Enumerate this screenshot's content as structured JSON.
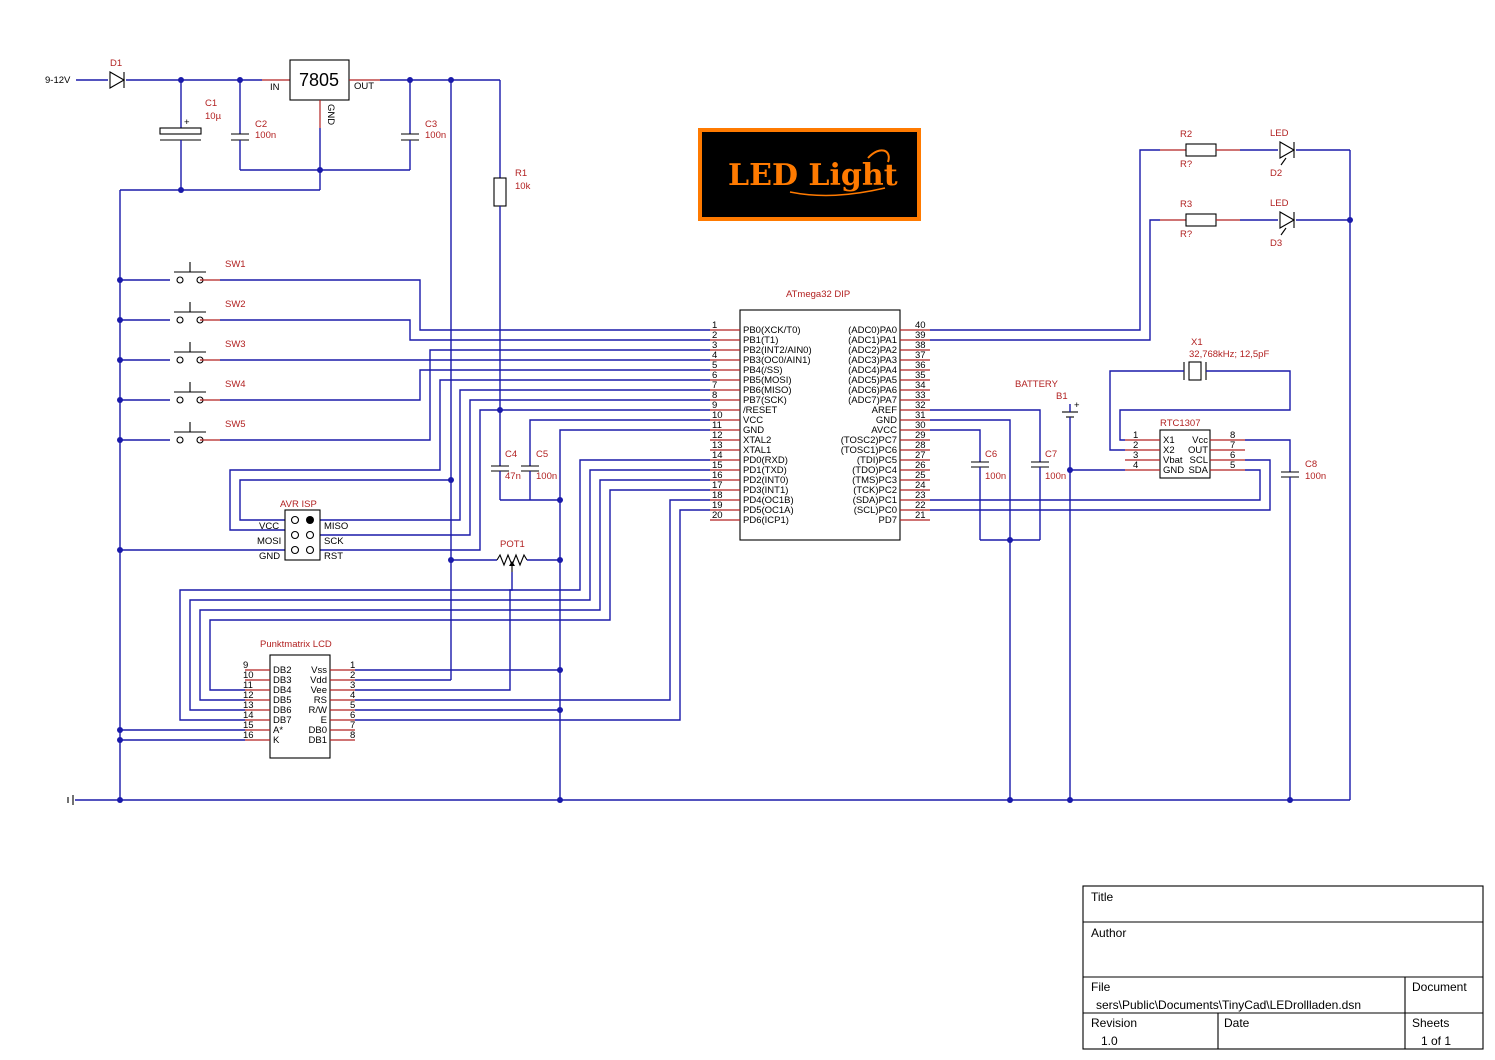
{
  "input_label": "9-12V",
  "components": {
    "d1": "D1",
    "c1": {
      "ref": "C1",
      "value": "10µ"
    },
    "c2": {
      "ref": "C2",
      "value": "100n"
    },
    "c3": {
      "ref": "C3",
      "value": "100n"
    },
    "c4": {
      "ref": "C4",
      "value": "47n"
    },
    "c5": {
      "ref": "C5",
      "value": "100n"
    },
    "c6": {
      "ref": "C6",
      "value": "100n"
    },
    "c7": {
      "ref": "C7",
      "value": "100n"
    },
    "c8": {
      "ref": "C8",
      "value": "100n"
    },
    "r1": {
      "ref": "R1",
      "value": "10k"
    },
    "r2": {
      "ref": "R2",
      "value": "R?"
    },
    "r3": {
      "ref": "R3",
      "value": "R?"
    },
    "led2": {
      "type": "LED",
      "ref": "D2"
    },
    "led3": {
      "type": "LED",
      "ref": "D3"
    },
    "regulator": {
      "name": "7805",
      "in": "IN",
      "out": "OUT",
      "gnd": "GND"
    },
    "switches": [
      "SW1",
      "SW2",
      "SW3",
      "SW4",
      "SW5"
    ],
    "pot": "POT1",
    "battery": {
      "label": "BATTERY",
      "ref": "B1"
    },
    "crystal": {
      "ref": "X1",
      "value": "32,768kHz; 12,5pF"
    },
    "isp": {
      "title": "AVR ISP",
      "left": [
        "VCC",
        "MOSI",
        "GND"
      ],
      "right": [
        "MISO",
        "SCK",
        "RST"
      ]
    },
    "rtc": {
      "title": "RTC1307",
      "left_pins": [
        {
          "num": "1",
          "name": "X1"
        },
        {
          "num": "2",
          "name": "X2"
        },
        {
          "num": "3",
          "name": "Vbat"
        },
        {
          "num": "4",
          "name": "GND"
        }
      ],
      "right_pins": [
        {
          "num": "8",
          "name": "Vcc"
        },
        {
          "num": "7",
          "name": "OUT"
        },
        {
          "num": "6",
          "name": "SCL"
        },
        {
          "num": "5",
          "name": "SDA"
        }
      ]
    },
    "lcd": {
      "title": "Punktmatrix LCD",
      "left_pins": [
        {
          "num": "9",
          "name": "DB2"
        },
        {
          "num": "10",
          "name": "DB3"
        },
        {
          "num": "11",
          "name": "DB4"
        },
        {
          "num": "12",
          "name": "DB5"
        },
        {
          "num": "13",
          "name": "DB6"
        },
        {
          "num": "14",
          "name": "DB7"
        },
        {
          "num": "15",
          "name": "A*"
        },
        {
          "num": "16",
          "name": "K"
        }
      ],
      "right_pins": [
        {
          "num": "1",
          "name": "Vss"
        },
        {
          "num": "2",
          "name": "Vdd"
        },
        {
          "num": "3",
          "name": "Vee"
        },
        {
          "num": "4",
          "name": "RS"
        },
        {
          "num": "5",
          "name": "R/W"
        },
        {
          "num": "6",
          "name": "E"
        },
        {
          "num": "7",
          "name": "DB0"
        },
        {
          "num": "8",
          "name": "DB1"
        }
      ]
    },
    "mcu": {
      "title": "ATmega32 DIP",
      "left_pins": [
        {
          "num": "1",
          "name": "PB0(XCK/T0)"
        },
        {
          "num": "2",
          "name": "PB1(T1)"
        },
        {
          "num": "3",
          "name": "PB2(INT2/AIN0)"
        },
        {
          "num": "4",
          "name": "PB3(OC0/AIN1)"
        },
        {
          "num": "5",
          "name": "PB4(/SS)"
        },
        {
          "num": "6",
          "name": "PB5(MOSI)"
        },
        {
          "num": "7",
          "name": "PB6(MISO)"
        },
        {
          "num": "8",
          "name": "PB7(SCK)"
        },
        {
          "num": "9",
          "name": "/RESET"
        },
        {
          "num": "10",
          "name": "VCC"
        },
        {
          "num": "11",
          "name": "GND"
        },
        {
          "num": "12",
          "name": "XTAL2"
        },
        {
          "num": "13",
          "name": "XTAL1"
        },
        {
          "num": "14",
          "name": "PD0(RXD)"
        },
        {
          "num": "15",
          "name": "PD1(TXD)"
        },
        {
          "num": "16",
          "name": "PD2(INT0)"
        },
        {
          "num": "17",
          "name": "PD3(INT1)"
        },
        {
          "num": "18",
          "name": "PD4(OC1B)"
        },
        {
          "num": "19",
          "name": "PD5(OC1A)"
        },
        {
          "num": "20",
          "name": "PD6(ICP1)"
        }
      ],
      "right_pins": [
        {
          "num": "40",
          "name": "(ADC0)PA0"
        },
        {
          "num": "39",
          "name": "(ADC1)PA1"
        },
        {
          "num": "38",
          "name": "(ADC2)PA2"
        },
        {
          "num": "37",
          "name": "(ADC3)PA3"
        },
        {
          "num": "36",
          "name": "(ADC4)PA4"
        },
        {
          "num": "35",
          "name": "(ADC5)PA5"
        },
        {
          "num": "34",
          "name": "(ADC6)PA6"
        },
        {
          "num": "33",
          "name": "(ADC7)PA7"
        },
        {
          "num": "32",
          "name": "AREF"
        },
        {
          "num": "31",
          "name": "GND"
        },
        {
          "num": "30",
          "name": "AVCC"
        },
        {
          "num": "29",
          "name": "(TOSC2)PC7"
        },
        {
          "num": "28",
          "name": "(TOSC1)PC6"
        },
        {
          "num": "27",
          "name": "(TDI)PC5"
        },
        {
          "num": "26",
          "name": "(TDO)PC4"
        },
        {
          "num": "25",
          "name": "(TMS)PC3"
        },
        {
          "num": "24",
          "name": "(TCK)PC2"
        },
        {
          "num": "23",
          "name": "(SDA)PC1"
        },
        {
          "num": "22",
          "name": "(SCL)PC0"
        },
        {
          "num": "21",
          "name": "PD7"
        }
      ]
    }
  },
  "logo": {
    "text": "LED Light",
    "background": "#000000",
    "border": "#ff7a00",
    "text_color": "#ff7a00"
  },
  "title_block": {
    "title_label": "Title",
    "author_label": "Author",
    "file_label": "File",
    "file_value": "sers\\Public\\Documents\\TinyCad\\LEDrollladen.dsn",
    "document_label": "Document",
    "revision_label": "Revision",
    "revision_value": "1.0",
    "date_label": "Date",
    "sheets_label": "Sheets",
    "sheets_value": "1 of 1"
  },
  "colors": {
    "wire": "#1a1aaa",
    "pin": "#b22222",
    "reference": "#b22222"
  }
}
